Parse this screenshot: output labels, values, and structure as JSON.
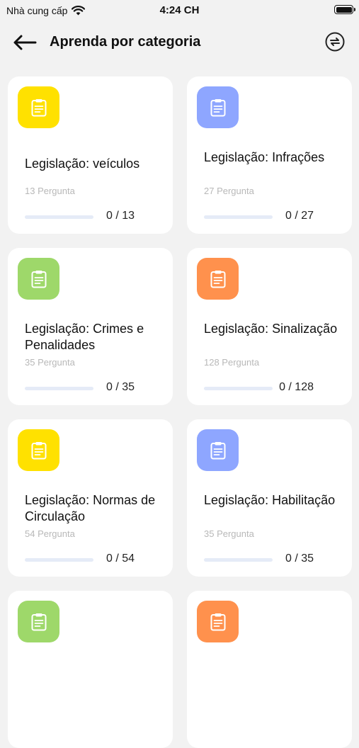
{
  "status_bar": {
    "carrier": "Nhà cung cấp",
    "time": "4:24 CH"
  },
  "header": {
    "title": "Aprenda por categoria",
    "back_icon": "arrow-left-icon",
    "swap_icon": "swap-circle-icon"
  },
  "colors": {
    "yellow": "#ffe100",
    "blue": "#8ea6ff",
    "green": "#9ed86a",
    "orange": "#ff914d"
  },
  "categories": [
    {
      "title": "Legislação: veículos",
      "count": "13 Pergunta",
      "progress": "0 / 13",
      "progress_fraction": 0,
      "icon_color": "#ffe100",
      "icon": "clipboard-icon"
    },
    {
      "title": "Legislação: Infrações",
      "count": "27 Pergunta",
      "progress": "0 / 27",
      "progress_fraction": 0,
      "icon_color": "#8ea6ff",
      "icon": "clipboard-icon"
    },
    {
      "title": "Legislação: Crimes e Penalidades",
      "count": "35 Pergunta",
      "progress": "0 / 35",
      "progress_fraction": 0,
      "icon_color": "#9ed86a",
      "icon": "clipboard-icon"
    },
    {
      "title": "Legislação: Sinalização",
      "count": "128 Pergunta",
      "progress": "0 / 128",
      "progress_fraction": 0,
      "icon_color": "#ff914d",
      "icon": "clipboard-icon"
    },
    {
      "title": "Legislação: Normas de Circulação",
      "count": "54 Pergunta",
      "progress": "0 / 54",
      "progress_fraction": 0,
      "icon_color": "#ffe100",
      "icon": "clipboard-icon"
    },
    {
      "title": "Legislação: Habilitação",
      "count": "35 Pergunta",
      "progress": "0 / 35",
      "progress_fraction": 0,
      "icon_color": "#8ea6ff",
      "icon": "clipboard-icon"
    },
    {
      "title": "",
      "count": "",
      "progress": "",
      "progress_fraction": 0,
      "icon_color": "#9ed86a",
      "icon": "clipboard-icon"
    },
    {
      "title": "",
      "count": "",
      "progress": "",
      "progress_fraction": 0,
      "icon_color": "#ff914d",
      "icon": "clipboard-icon"
    }
  ]
}
